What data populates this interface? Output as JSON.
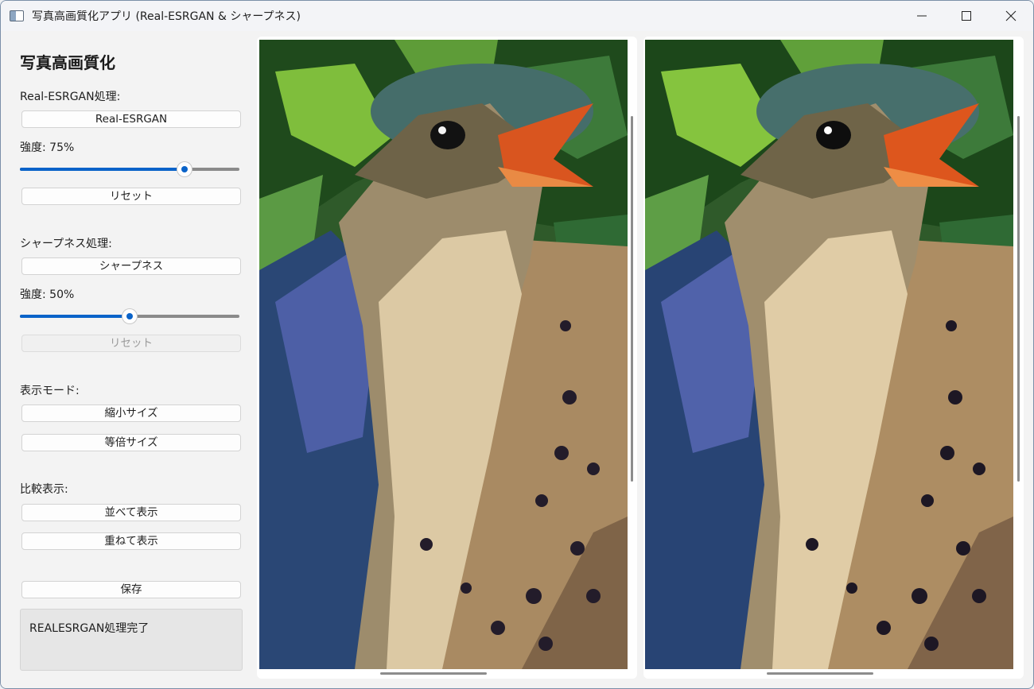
{
  "window": {
    "title": "写真高画質化アプリ (Real-ESRGAN & シャープネス)",
    "controls": [
      "minimize-icon",
      "maximize-icon",
      "close-icon"
    ]
  },
  "sidebar": {
    "heading": "写真高画質化",
    "esrgan": {
      "label": "Real-ESRGAN処理:",
      "button": "Real-ESRGAN",
      "strength_label": "強度: 75%",
      "strength": 0.75,
      "reset": "リセット"
    },
    "sharpness": {
      "label": "シャープネス処理:",
      "button": "シャープネス",
      "strength_label": "強度: 50%",
      "strength": 0.5,
      "reset": "リセット"
    },
    "display_mode": {
      "label": "表示モード:",
      "shrink": "縮小サイズ",
      "actual": "等倍サイズ"
    },
    "compare": {
      "label": "比較表示:",
      "side_by_side": "並べて表示",
      "overlay": "重ねて表示"
    },
    "save": "保存",
    "status": "REALESRGAN処理完了"
  },
  "colors": {
    "accent": "#0a63c9",
    "panel": "#ffffff",
    "sidebar": "#f3f3f3"
  }
}
